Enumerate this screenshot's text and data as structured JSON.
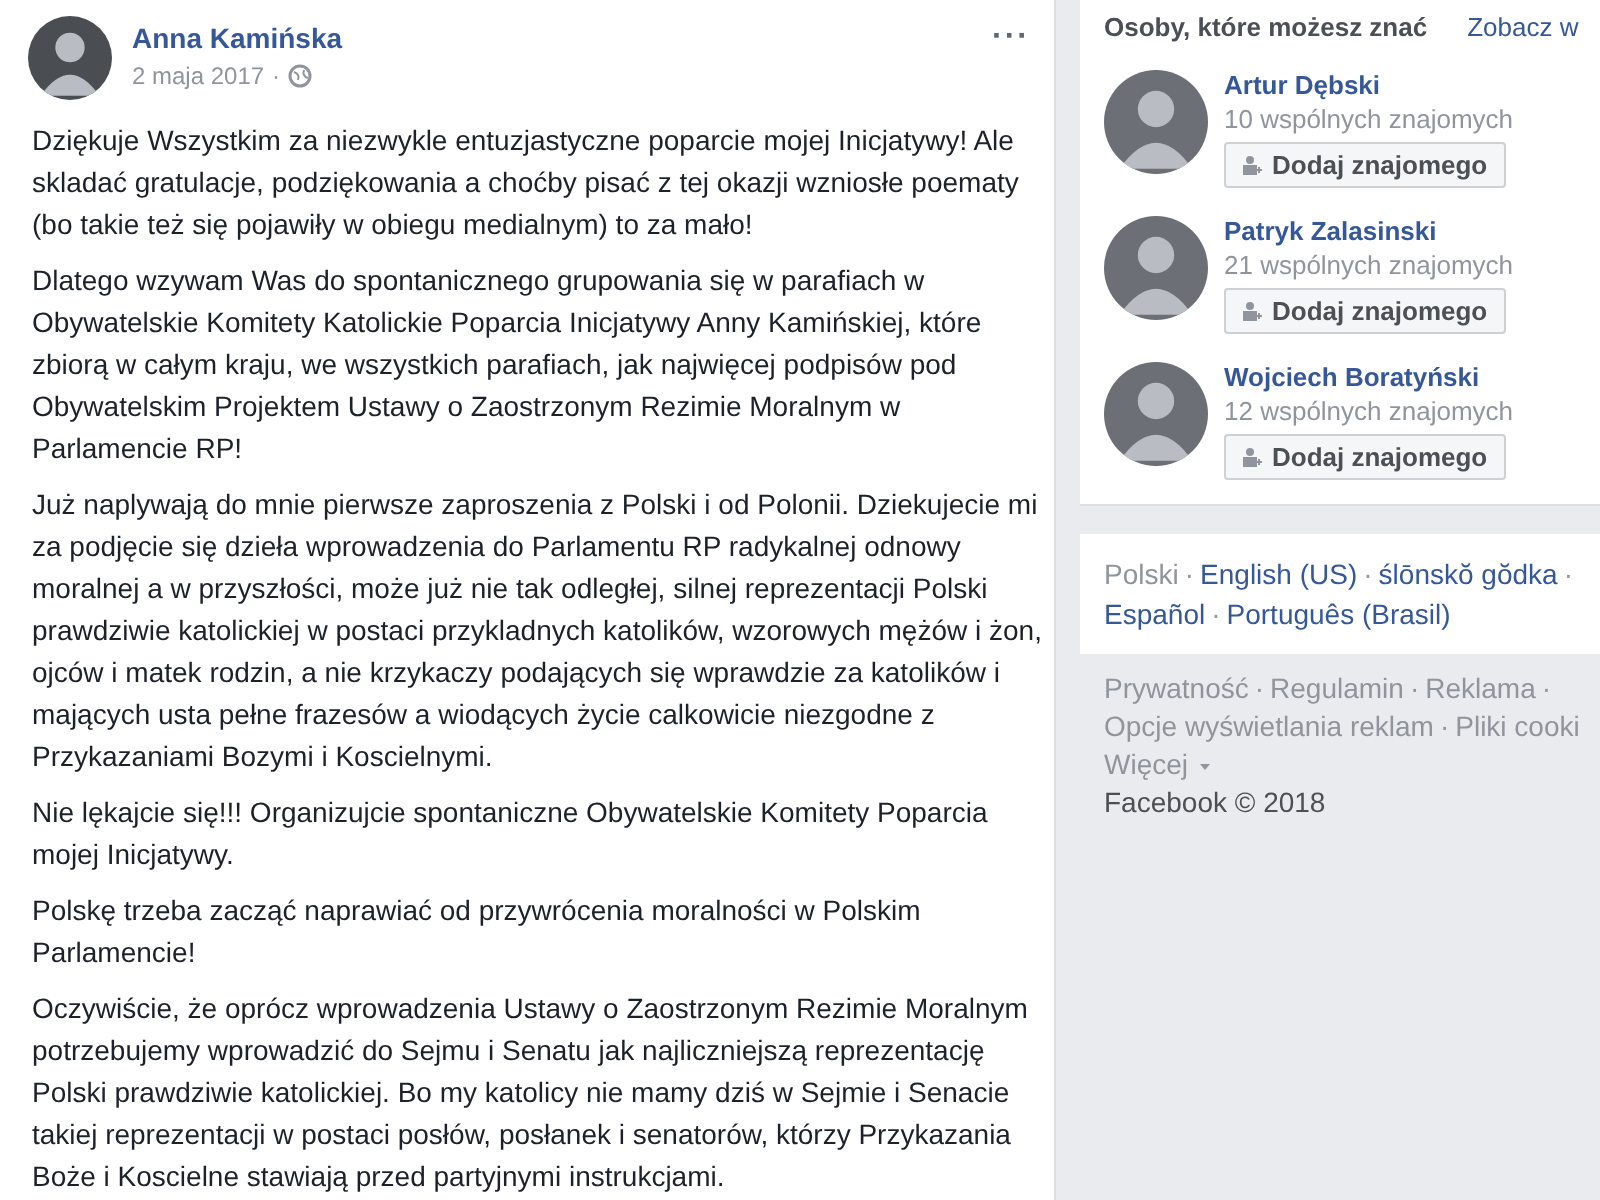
{
  "post": {
    "author": "Anna Kamińska",
    "date": "2 maja 2017",
    "date_separator": "·",
    "menu": "···",
    "paragraphs": [
      "Dziękuje Wszystkim za niezwykle entuzjastyczne poparcie mojej Inicjatywy! Ale skladać gratulacje, podziękowania a choćby pisać z tej okazji wzniosłe poematy (bo takie też się pojawiły w obiegu medialnym) to za mało!",
      "Dlatego wzywam Was do spontanicznego grupowania się w parafiach w Obywatelskie Komitety Katolickie Poparcia Inicjatywy Anny Kamińskiej, które zbiorą w całym kraju, we wszystkich parafiach, jak najwięcej podpisów pod Obywatelskim Projektem Ustawy o Zaostrzonym Rezimie Moralnym w Parlamencie RP!",
      "Już naplywają do mnie pierwsze zaproszenia z Polski i od Polonii. Dziekujecie mi za podjęcie się dzieła wprowadzenia do Parlamentu RP radykalnej odnowy moralnej a w przyszłości, może już nie tak odległej, silnej reprezentacji Polski prawdziwie katolickiej w postaci przykladnych katolików, wzorowych mężów i żon, ojców i matek rodzin, a nie krzykaczy podających się wprawdzie za katolików i mających usta pełne frazesów a wiodących życie calkowicie niezgodne z Przykazaniami Bozymi i Koscielnymi.",
      "Nie lękajcie się!!! Organizujcie spontaniczne Obywatelskie Komitety Poparcia mojej Inicjatywy.",
      "Polskę trzeba zacząć naprawiać od przywrócenia moralności w Polskim Parlamencie!",
      "Oczywiście, że oprócz wprowadzenia Ustawy o Zaostrzonym Rezimie Moralnym potrzebujemy wprowadzić do Sejmu i Senatu jak najliczniejszą reprezentację Polski prawdziwie katolickiej. Bo my katolicy nie mamy dziś w Sejmie i Senacie takiej reprezentacji w postaci posłów, posłanek i senatorów, którzy Przykazania Boże i Koscielne stawiają przed partyjnymi instrukcjami."
    ]
  },
  "suggestions": {
    "title": "Osoby, które możesz znać",
    "see_all": "Zobacz w",
    "people": [
      {
        "name": "Artur Dębski",
        "mutual": "10 wspólnych znajomych",
        "button": "Dodaj znajomego"
      },
      {
        "name": "Patryk Zalasinski",
        "mutual": "21 wspólnych znajomych",
        "button": "Dodaj znajomego"
      },
      {
        "name": "Wojciech Boratyński",
        "mutual": "12 wspólnych znajomych",
        "button": "Dodaj znajomego"
      }
    ]
  },
  "separator": "·",
  "languages": [
    {
      "label": "Polski",
      "selected": true
    },
    {
      "label": "English (US)",
      "selected": false
    },
    {
      "label": "ślōnskŏ gŏdka",
      "selected": false
    },
    {
      "label": "Español",
      "selected": false
    },
    {
      "label": "Português (Brasil)",
      "selected": false
    }
  ],
  "footer": {
    "links": [
      "Prywatność",
      "Regulamin",
      "Reklama",
      "Opcje wyświetlania reklam",
      "Pliki cooki",
      "Więcej"
    ],
    "copyright": "Facebook © 2018"
  }
}
